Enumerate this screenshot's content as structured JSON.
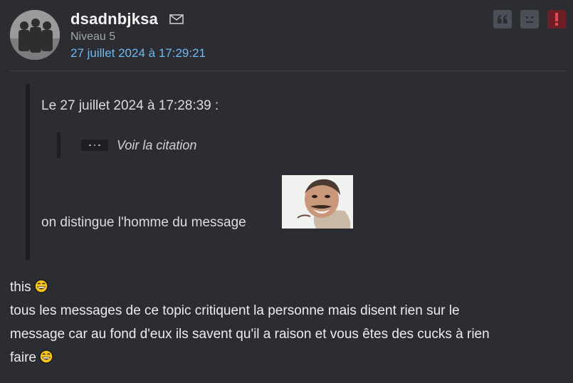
{
  "author": {
    "name": "dsadnbjksa",
    "level": "Niveau 5",
    "date": "27 juillet 2024 à 17:29:21",
    "avatar_icon": "avatar-photo"
  },
  "actions": [
    {
      "name": "quote-action",
      "icon": "quote-icon"
    },
    {
      "name": "sad-action",
      "icon": "sad-face-icon"
    },
    {
      "name": "report-action",
      "icon": "exclamation-icon",
      "color": "#6e1e26"
    }
  ],
  "quote": {
    "header": "Le 27 juillet 2024 à 17:28:39 :",
    "see_quote": "Voir la citation",
    "text": "on distingue l'homme du message",
    "sticker": "laughing-man-sticker"
  },
  "message": {
    "line1": "this",
    "line2": "tous les messages de ce topic critiquent la personne mais disent rien sur le",
    "line3": "message car au fond d'eux ils savent qu'il a raison et vous êtes des cucks à rien",
    "line4": "faire",
    "smiley": "laughing-smiley"
  },
  "colors": {
    "background": "#2b2d33",
    "link": "#6fb8f0",
    "report": "#6e1e26"
  }
}
